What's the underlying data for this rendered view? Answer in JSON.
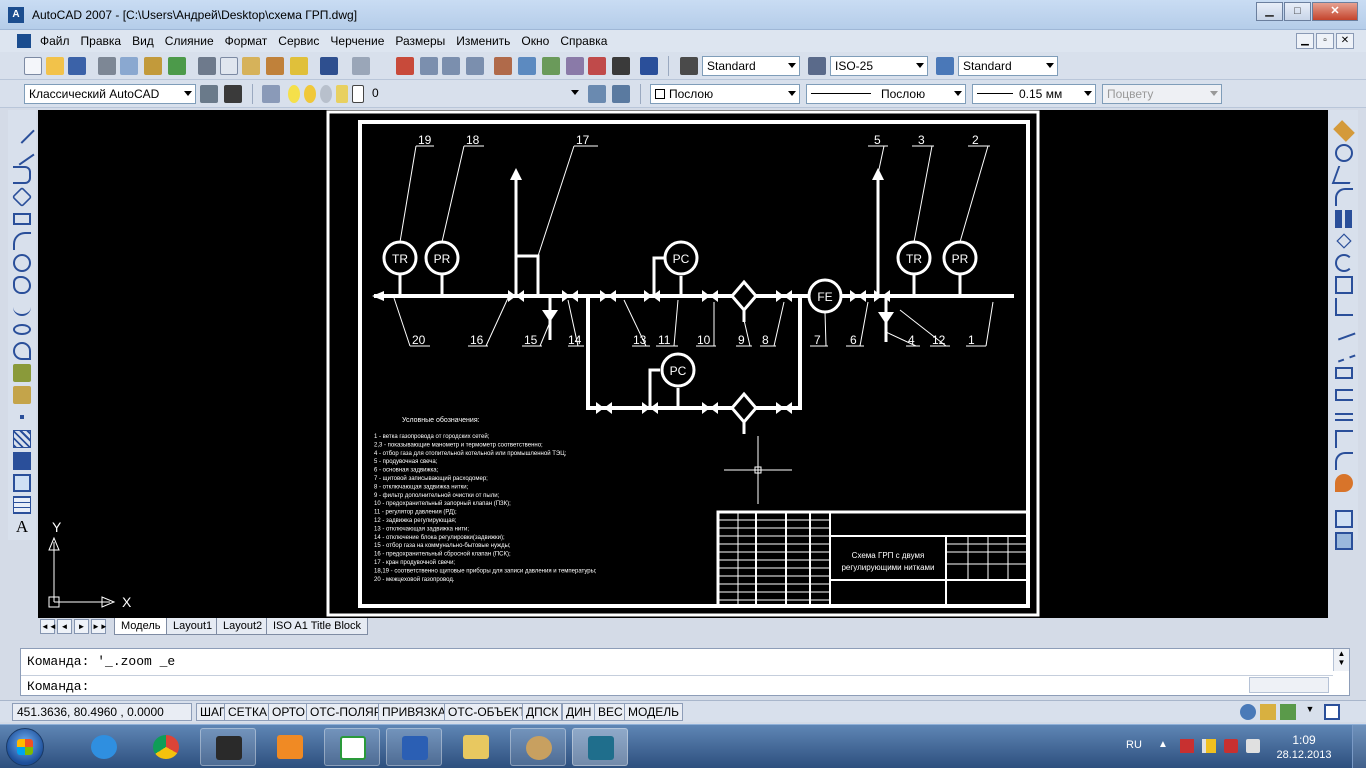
{
  "window": {
    "app_icon_letter": "A",
    "title": "AutoCAD 2007 - [C:\\Users\\Андрей\\Desktop\\схема ГРП.dwg]",
    "minimize": "▁",
    "maximize": "□",
    "close": "✕"
  },
  "menu": {
    "items": [
      "Файл",
      "Правка",
      "Вид",
      "Слияние",
      "Формат",
      "Сервис",
      "Черчение",
      "Размеры",
      "Изменить",
      "Окно",
      "Справка"
    ],
    "mdi_min": "▁",
    "mdi_restore": "▫",
    "mdi_close": "✕"
  },
  "toolbars": {
    "text_style": "Standard",
    "dim_style": "ISO-25",
    "table_style": "Standard",
    "workspace": "Классический AutoCAD",
    "layer": "0",
    "color": "Послою",
    "linetype": "Послою",
    "lineweight": "0.15 мм",
    "plotstyle": "Поцвету"
  },
  "drawing": {
    "labels_top": [
      "19",
      "18",
      "17",
      "5",
      "3",
      "2"
    ],
    "labels_bottom": [
      "20",
      "16",
      "15",
      "14",
      "13",
      "11",
      "10",
      "9",
      "8",
      "7",
      "6",
      "4",
      "12",
      "1"
    ],
    "instruments": [
      "TR",
      "PR",
      "PC",
      "FE",
      "TR",
      "PR",
      "PC"
    ],
    "legend_title": "Условные обозначения:",
    "legend": [
      "1 - ветка газопровода от городских сетей;",
      "2,3 - показывающие манометр и термометр соответственно;",
      "4 - отбор газа для отопительной котельной или промышленной ТЭЦ;",
      "5 - продувочная свеча;",
      "6 - основная задвижка;",
      "7 - щитовой записывающий расходомер;",
      "8 - отключающая задвижка нитки;",
      "9 - фильтр дополнительной очистки от пыли;",
      "10 - предохранительный запорный клапан (ПЗК);",
      "11 - регулятор давления (РД);",
      "12 - задвижка регулирующая;",
      "13 - отключающая задвижка нити;",
      "14 - отключение блока регулировки(задвижки);",
      "15 - отбор газа на коммунально-бытовые нужды;",
      "16 - предохранительный сбросной клапан (ПСК);",
      "17 - кран продувочной свечи;",
      "18,19 - соответственно щитовые приборы для записи давления и температуры;",
      "20 - межцеховой газопровод."
    ],
    "title_block_line1": "Схема ГРП с двумя",
    "title_block_line2": "регулирующими нитками",
    "ucs_x": "X",
    "ucs_y": "Y"
  },
  "layout_tabs": {
    "nav": [
      "◄◄",
      "◄",
      "►",
      "►►"
    ],
    "tabs": [
      "Модель",
      "Layout1",
      "Layout2",
      "ISO A1 Title Block"
    ]
  },
  "command": {
    "history": "Команда: '_.zoom _e",
    "prompt": "Команда:"
  },
  "status": {
    "coords": "451.3636, 80.4960 , 0.0000",
    "buttons": [
      "ШАГ",
      "СЕТКА",
      "ОРТО",
      "ОТС-ПОЛЯР",
      "ПРИВЯЗКА",
      "ОТС-ОБЪЕКТ",
      "ДПСК",
      "ДИН",
      "ВЕС",
      "МОДЕЛЬ"
    ]
  },
  "taskbar": {
    "lang": "RU",
    "time": "1:09",
    "date": "28.12.2013"
  }
}
